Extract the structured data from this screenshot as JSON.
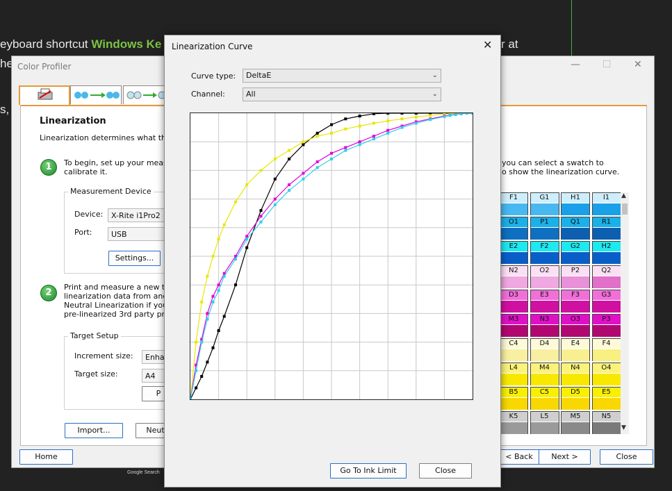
{
  "background": {
    "line1_prefix": "eyboard shortcut",
    "line1_green": "Windows Ke",
    "line1_suffix": "r at",
    "line2": "he",
    "line3": "s,",
    "google_text": "Google Search"
  },
  "profiler": {
    "title": "Color Profiler",
    "heading": "Linearization",
    "intro": "Linearization determines what the c",
    "step1_text_line1": "To begin, set up your measure",
    "step1_text_line2": "calibrate it.",
    "device_group_label": "Measurement Device",
    "device_label": "Device:",
    "device_value": "X-Rite i1Pro2",
    "port_label": "Port:",
    "port_value": "USB",
    "settings_button": "Settings...",
    "step2_line1": "Print and measure a new targ",
    "step2_line2": "linearization data from another",
    "step2_line3": "Neutral Linearization if you are",
    "step2_line4": "pre-linearized 3rd party profile",
    "target_group_label": "Target Setup",
    "increment_label": "Increment size:",
    "increment_value": "Enhan",
    "target_size_label": "Target size:",
    "target_size_value": "A4",
    "print_button": "P",
    "import_button": "Import...",
    "neutral_button": "Neut",
    "right_text_line1": "you can select a swatch to",
    "right_text_line2": "o show the linearization curve.",
    "home_button": "Home",
    "back_button": "< Back",
    "next_button": "Next >",
    "close_button": "Close",
    "minimize_glyph": "—",
    "maximize_glyph": "☐",
    "close_glyph": "✕"
  },
  "swatches": [
    {
      "labels": [
        "F1",
        "G1",
        "H1",
        "I1"
      ],
      "colors": [
        "#48b8f0",
        "#48b8f0",
        "#1aa0e8",
        "#1aa0e8"
      ],
      "label_bg": [
        "#cfeefc",
        "#cfeefc",
        "#cfeefc",
        "#cfeefc"
      ]
    },
    {
      "labels": [
        "O1",
        "P1",
        "Q1",
        "R1"
      ],
      "colors": [
        "#0f6fc0",
        "#0f6fc0",
        "#0d5fb0",
        "#0d5fb0"
      ],
      "label_bg": [
        "#1ab0e8",
        "#1ab0e8",
        "#1ab0e8",
        "#1ab0e8"
      ]
    },
    {
      "labels": [
        "E2",
        "F2",
        "G2",
        "H2"
      ],
      "colors": [
        "#0a5ec8",
        "#0a5ec8",
        "#0a5ec8",
        "#0a5ec8"
      ],
      "label_bg": [
        "#1ee8f0",
        "#1ee8f0",
        "#1ee8f0",
        "#1ee8f0"
      ]
    },
    {
      "labels": [
        "N2",
        "O2",
        "P2",
        "Q2"
      ],
      "colors": [
        "#f0a8e0",
        "#f0a8e0",
        "#e890d8",
        "#e070c8"
      ],
      "label_bg": [
        "#fbe0f4",
        "#fbe0f4",
        "#fbe0f4",
        "#fbe0f4"
      ]
    },
    {
      "labels": [
        "D3",
        "E3",
        "F3",
        "G3"
      ],
      "colors": [
        "#d010a0",
        "#d010a0",
        "#d010a0",
        "#d010a0"
      ],
      "label_bg": [
        "#f070d8",
        "#f070d8",
        "#f070d8",
        "#f070d8"
      ]
    },
    {
      "labels": [
        "M3",
        "N3",
        "O3",
        "P3"
      ],
      "colors": [
        "#b00870",
        "#b00870",
        "#b00870",
        "#b00870"
      ],
      "label_bg": [
        "#e010c8",
        "#e010c8",
        "#e010c8",
        "#e010c8"
      ]
    },
    {
      "labels": [
        "C4",
        "D4",
        "E4",
        "F4"
      ],
      "colors": [
        "#f8f0a0",
        "#f8f0a0",
        "#f8f090",
        "#f8f080"
      ],
      "label_bg": [
        "#fdfad8",
        "#fdfad8",
        "#fdfad8",
        "#fdfad8"
      ]
    },
    {
      "labels": [
        "L4",
        "M4",
        "N4",
        "O4"
      ],
      "colors": [
        "#f8e800",
        "#f8e800",
        "#f8e800",
        "#f8e800"
      ],
      "label_bg": [
        "#fbf27a",
        "#fbf27a",
        "#fbf27a",
        "#fbf27a"
      ]
    },
    {
      "labels": [
        "B5",
        "C5",
        "D5",
        "E5"
      ],
      "colors": [
        "#f8d800",
        "#f8d800",
        "#f8d800",
        "#f8d800"
      ],
      "label_bg": [
        "#f8f000",
        "#f8f000",
        "#f8f000",
        "#f8f000"
      ]
    },
    {
      "labels": [
        "K5",
        "L5",
        "M5",
        "N5"
      ],
      "colors": [
        "#9a9a9a",
        "#9a9a9a",
        "#8a8a8a",
        "#7a7a7a"
      ],
      "label_bg": [
        "#cfcfcf",
        "#cfcfcf",
        "#cfcfcf",
        "#cfcfcf"
      ]
    }
  ],
  "dialog": {
    "title": "Linearization Curve",
    "close_glyph": "✕",
    "curve_type_label": "Curve type:",
    "curve_type_value": "DeltaE",
    "channel_label": "Channel:",
    "channel_value": "All",
    "go_to_ink_limit_button": "Go To Ink Limit",
    "close_button": "Close"
  },
  "chart_data": {
    "type": "line",
    "title": "",
    "xlabel": "",
    "ylabel": "",
    "xlim": [
      0,
      100
    ],
    "ylim": [
      0,
      100
    ],
    "grid": true,
    "legend": "none",
    "x": [
      0,
      2,
      4,
      6,
      8,
      10,
      12,
      16,
      20,
      25,
      30,
      35,
      40,
      45,
      50,
      55,
      60,
      65,
      70,
      75,
      80,
      85,
      90,
      92,
      94,
      96,
      98,
      100
    ],
    "series": [
      {
        "name": "",
        "color": "#000000",
        "values": [
          0,
          4,
          8,
          13,
          18,
          24,
          29,
          40,
          53,
          66,
          77,
          84,
          89,
          93,
          96,
          98,
          99,
          99.8,
          100,
          100,
          100,
          100,
          100,
          100,
          100,
          100,
          100,
          100
        ]
      },
      {
        "name": "",
        "color": "#e8e800",
        "values": [
          0,
          20,
          34,
          43,
          50,
          56,
          61,
          69,
          75,
          80,
          84,
          87,
          90,
          92,
          93,
          94.5,
          95.5,
          96.5,
          97.3,
          98,
          98.7,
          99.2,
          99.7,
          99.8,
          99.9,
          100,
          100,
          100
        ]
      },
      {
        "name": "",
        "color": "#e000e0",
        "values": [
          0,
          12,
          21,
          30,
          36,
          40,
          44,
          50,
          57,
          64,
          70,
          75,
          79,
          83,
          86,
          88,
          90,
          92,
          94,
          95.5,
          97,
          98,
          99,
          99.3,
          99.6,
          99.8,
          100,
          100
        ]
      },
      {
        "name": "",
        "color": "#30d0e8",
        "values": [
          0,
          10,
          20,
          28,
          34,
          38,
          43,
          49,
          56,
          62,
          68,
          73,
          77,
          81,
          84,
          87,
          89,
          91,
          93,
          95,
          96.5,
          97.8,
          98.8,
          99.2,
          99.5,
          99.8,
          100,
          100
        ]
      }
    ]
  }
}
